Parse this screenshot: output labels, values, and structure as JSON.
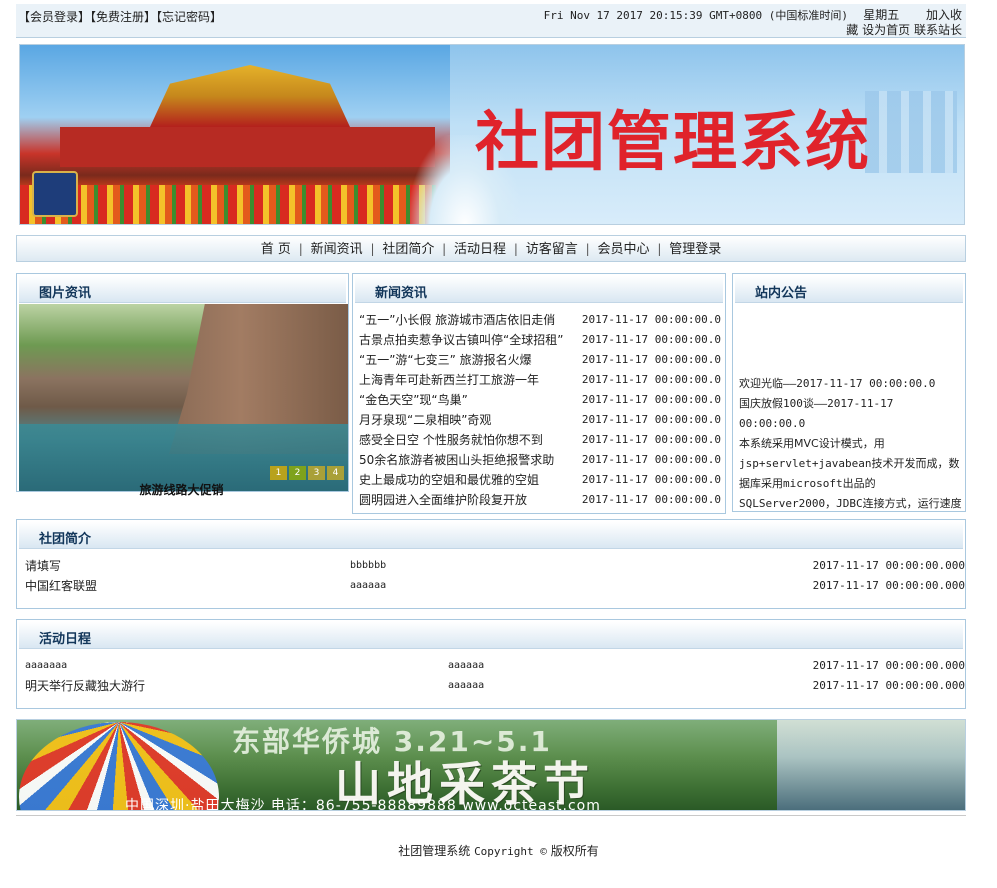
{
  "topbar": {
    "links": [
      "【会员登录】",
      "【免费注册】",
      "【忘记密码】"
    ],
    "clock": "Fri Nov 17 2017 20:15:39 GMT+0800 (中国标准时间)",
    "weekday": "星期五",
    "add_favorite": "加入收藏",
    "set_home": "设为首页",
    "contact": "联系站长"
  },
  "banner": {
    "title": "社团管理系统"
  },
  "nav": {
    "items": [
      "首 页",
      "新闻资讯",
      "社团简介",
      "活动日程",
      "访客留言",
      "会员中心",
      "管理登录"
    ],
    "separator": "|"
  },
  "picture_news": {
    "title": "图片资讯",
    "pager": [
      "1",
      "2",
      "3",
      "4"
    ],
    "caption": "旅游线路大促销"
  },
  "news": {
    "title": "新闻资讯",
    "items": [
      {
        "title": "“五一”小长假 旅游城市酒店依旧走俏",
        "date": "2017-11-17 00:00:00.0"
      },
      {
        "title": "古景点拍卖惹争议古镇叫停“全球招租”",
        "date": "2017-11-17 00:00:00.0"
      },
      {
        "title": "“五一”游“七变三” 旅游报名火爆",
        "date": "2017-11-17 00:00:00.0"
      },
      {
        "title": "上海青年可赴新西兰打工旅游一年",
        "date": "2017-11-17 00:00:00.0"
      },
      {
        "title": "“金色天空”现“鸟巢”",
        "date": "2017-11-17 00:00:00.0"
      },
      {
        "title": "月牙泉现“二泉相映”奇观",
        "date": "2017-11-17 00:00:00.0"
      },
      {
        "title": "感受全日空 个性服务就怕你想不到",
        "date": "2017-11-17 00:00:00.0"
      },
      {
        "title": "50余名旅游者被困山头拒绝报警求助",
        "date": "2017-11-17 00:00:00.0"
      },
      {
        "title": "史上最成功的空姐和最优雅的空姐",
        "date": "2017-11-17 00:00:00.0"
      },
      {
        "title": "圆明园进入全面维护阶段复开放",
        "date": "2017-11-17 00:00:00.0"
      }
    ]
  },
  "notice": {
    "title": "站内公告",
    "items": [
      {
        "text": "欢迎光临——2017-11-17 00:00:00.0"
      },
      {
        "text": "国庆放假100谈——2017-11-17 00:00:00.0"
      }
    ],
    "desc_1": "本系统采用MVC设计模式，用",
    "desc_2": "jsp+servlet+javabean技术开发而成，数",
    "desc_3": "据库采用microsoft出品的",
    "desc_4": "SQLServer2000，JDBC连接方式，运行速度"
  },
  "club": {
    "title": "社团简介",
    "rows": [
      {
        "name": "请填写",
        "content": "bbbbbb",
        "date": "2017-11-17 00:00:00.000"
      },
      {
        "name": "中国红客联盟",
        "content": "aaaaaa",
        "date": "2017-11-17 00:00:00.000"
      }
    ]
  },
  "activity": {
    "title": "活动日程",
    "rows": [
      {
        "name": "aaaaaaa",
        "content": "aaaaaa",
        "date": "2017-11-17 00:00:00.000"
      },
      {
        "name": "明天举行反藏独大游行",
        "content": "aaaaaa",
        "date": "2017-11-17 00:00:00.000"
      }
    ]
  },
  "ad": {
    "line1": "东部华侨城 3.21~5.1",
    "line2": "山地采茶节",
    "line3": "中国深圳·盐田大梅沙   电话：86-755-88889888   www.octeast.com"
  },
  "footer": {
    "copyright_prefix": "社团管理系统",
    "copyright_mid": "Copyright ©",
    "copyright_suffix": "版权所有"
  }
}
